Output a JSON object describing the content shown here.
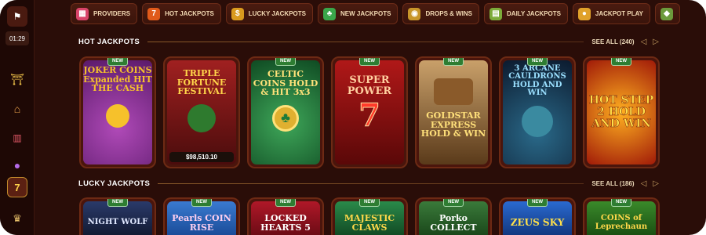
{
  "rail": {
    "clock": "01:29",
    "icons": [
      "flag-icon",
      "lantern-icon",
      "temple-icon",
      "slot-reels-icon",
      "genie-icon",
      "seven-chip-icon",
      "crown-icon"
    ]
  },
  "categories": [
    {
      "label": "Providers",
      "icon": "providers-icon",
      "color": "#d8446a"
    },
    {
      "label": "Hot Jackpots",
      "icon": "seven-icon",
      "color": "#e05a1a"
    },
    {
      "label": "Lucky Jackpots",
      "icon": "money-bag-icon",
      "color": "#d99a1e"
    },
    {
      "label": "New Jackpots",
      "icon": "clover-icon",
      "color": "#3aa64a"
    },
    {
      "label": "Drops & Wins",
      "icon": "coins-icon",
      "color": "#c8962a"
    },
    {
      "label": "Daily Jackpots",
      "icon": "calendar-icon",
      "color": "#7cab3a"
    },
    {
      "label": "Jackpot Play",
      "icon": "coin-icon",
      "color": "#e0a12a"
    },
    {
      "label": "",
      "icon": "lucky-icon",
      "color": "#6c9a3c"
    }
  ],
  "hot": {
    "title": "HOT JACKPOTS",
    "see_all": "SEE ALL (240)",
    "games": [
      {
        "name": "JOKER COINS Expanded HIT THE CASH",
        "new": "NEW",
        "bg": "#7a2a8a",
        "accent": "#f6c12b",
        "jackpot": ""
      },
      {
        "name": "TRIPLE FORTUNE FESTIVAL",
        "new": "",
        "bg": "#7a1a1a",
        "accent": "#ffd54a",
        "jackpot": "$98,510.10"
      },
      {
        "name": "CELTIC COINS HOLD & HIT 3x3",
        "new": "NEW",
        "bg": "#1c7a3a",
        "accent": "#ffe27a",
        "jackpot": ""
      },
      {
        "name": "SUPER POWER",
        "new": "NEW",
        "bg": "#8a1010",
        "accent": "#ffd0a0",
        "jackpot": ""
      },
      {
        "name": "GOLDSTAR EXPRESS HOLD & WIN",
        "new": "NEW",
        "bg": "#6a4a2a",
        "accent": "#ffe07a",
        "jackpot": ""
      },
      {
        "name": "3 ARCANE CAULDRONS HOLD AND WIN",
        "new": "NEW",
        "bg": "#1a3a5a",
        "accent": "#9be0ff",
        "jackpot": ""
      },
      {
        "name": "HOT STEP 2 HOLD AND WIN",
        "new": "NEW",
        "bg": "#c03a10",
        "accent": "#ffe04a",
        "jackpot": ""
      }
    ]
  },
  "lucky": {
    "title": "LUCKY JACKPOTS",
    "see_all": "SEE ALL (186)",
    "games": [
      {
        "name": "NIGHT WOLF",
        "new": "NEW",
        "bg": "#1a2a4a",
        "accent": "#e0e8ff"
      },
      {
        "name": "Pearls COIN RISE",
        "new": "NEW",
        "bg": "#1a5aa0",
        "accent": "#ffd0f0"
      },
      {
        "name": "LOCKED HEARTS 5",
        "new": "NEW",
        "bg": "#8a1020",
        "accent": "#ffffff"
      },
      {
        "name": "MAJESTIC CLAWS",
        "new": "NEW",
        "bg": "#1a6a3a",
        "accent": "#ffd84a"
      },
      {
        "name": "Porko COLLECT",
        "new": "NEW",
        "bg": "#2a5a2a",
        "accent": "#ffffff"
      },
      {
        "name": "ZEUS SKY",
        "new": "NEW",
        "bg": "#1a4a9a",
        "accent": "#ffe04a"
      },
      {
        "name": "COINS of Leprechaun",
        "new": "NEW",
        "bg": "#2a6a1a",
        "accent": "#ffd84a"
      }
    ]
  }
}
